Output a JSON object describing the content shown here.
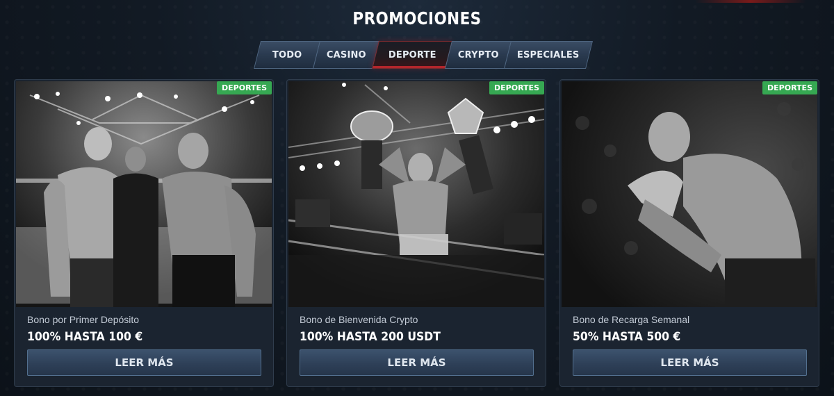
{
  "page": {
    "title": "PROMOCIONES"
  },
  "tabs": [
    {
      "label": "TODO",
      "active": false
    },
    {
      "label": "CASINO",
      "active": false
    },
    {
      "label": "DEPORTE",
      "active": true
    },
    {
      "label": "CRYPTO",
      "active": false
    },
    {
      "label": "ESPECIALES",
      "active": false
    }
  ],
  "colors": {
    "badge_green": "#36a852",
    "active_tab_accent": "#b3262c",
    "button_blue": "#2e4058"
  },
  "cards": [
    {
      "badge": "DEPORTES",
      "image": "fighters-faceoff-photo",
      "subtitle": "Bono por Primer Depósito",
      "amount": "100% HASTA 100 €",
      "button": "LEER MÁS"
    },
    {
      "badge": "DEPORTES",
      "image": "champion-belts-photo",
      "subtitle": "Bono de Bienvenida Crypto",
      "amount": "100% HASTA 200 USDT",
      "button": "LEER MÁS"
    },
    {
      "badge": "DEPORTES",
      "image": "fighter-guard-photo",
      "subtitle": "Bono de Recarga Semanal",
      "amount": "50% HASTA 500 €",
      "button": "LEER MÁS"
    }
  ]
}
